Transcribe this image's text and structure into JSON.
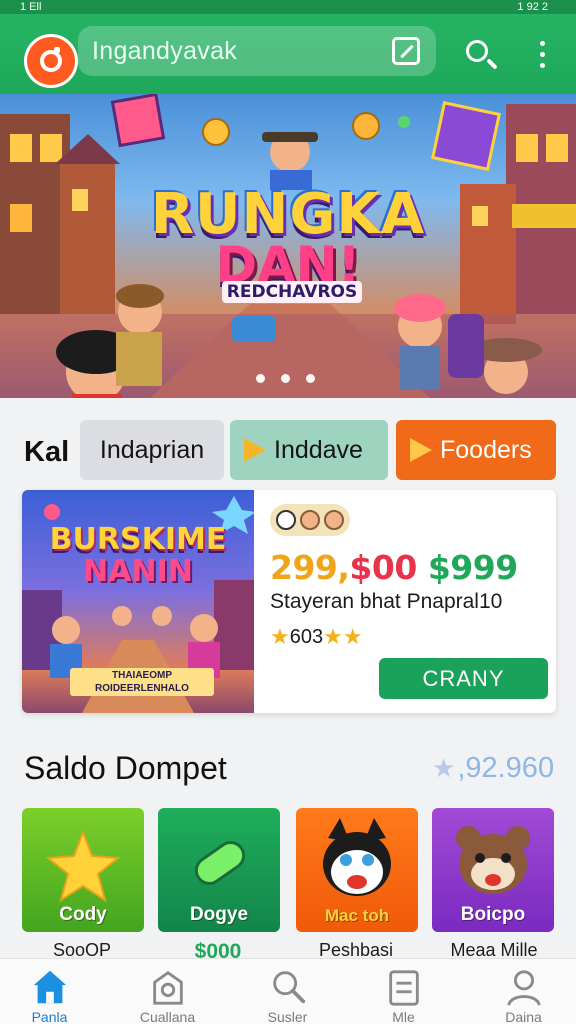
{
  "status_bar": {
    "left": "1 Ell",
    "right": "1 92 2"
  },
  "header": {
    "logo_icon": "app-logo-icon",
    "search_text": "Ingandyavak",
    "edit_icon": "edit-icon",
    "search_icon": "search-icon",
    "menu_icon": "more-vert-icon",
    "color": "#22ad5f"
  },
  "hero": {
    "title_line1": "RUNGKA",
    "title_line2": "DAN!",
    "title_line3": "REDCHAVROS",
    "carousel_dots": 3
  },
  "filters": {
    "label": "Kal",
    "chips": [
      {
        "label": "Indaprian",
        "color": "#dcdde2"
      },
      {
        "label": "Inddave",
        "color": "#9ed4bf"
      },
      {
        "label": "Fooders",
        "color": "#f06a1a"
      }
    ]
  },
  "featured": {
    "image_title_line1": "BURSKIME",
    "image_title_line2": "NANIN",
    "image_caption": "THAIAEOMP ROIDEERLENHALO",
    "price_a": "299,",
    "price_b": "$00",
    "price_c": "$999",
    "description": "Stayeran bhat Pnapral10",
    "rating": "603",
    "button_label": "CRANY"
  },
  "wallet": {
    "title": "Saldo Dompet",
    "value": ",92.960",
    "apps": [
      {
        "label": "Cody",
        "sub": "SooOP",
        "color": "#5cbf24"
      },
      {
        "label": "Dogye",
        "sub": "$000",
        "color": "#18a055"
      },
      {
        "label": "Mac toh",
        "sub": "Peshbasi",
        "color": "#f86a12"
      },
      {
        "label": "Boicpo",
        "sub": "Meaa Mille",
        "color": "#9038cc"
      }
    ]
  },
  "bottom_nav": {
    "active_color": "#1b7fcf",
    "items": [
      {
        "label": "Panla",
        "icon": "home-icon"
      },
      {
        "label": "Cuallana",
        "icon": "bag-icon"
      },
      {
        "label": "Susler",
        "icon": "search-icon"
      },
      {
        "label": "Mle",
        "icon": "list-icon"
      },
      {
        "label": "Daina",
        "icon": "profile-icon"
      }
    ]
  }
}
